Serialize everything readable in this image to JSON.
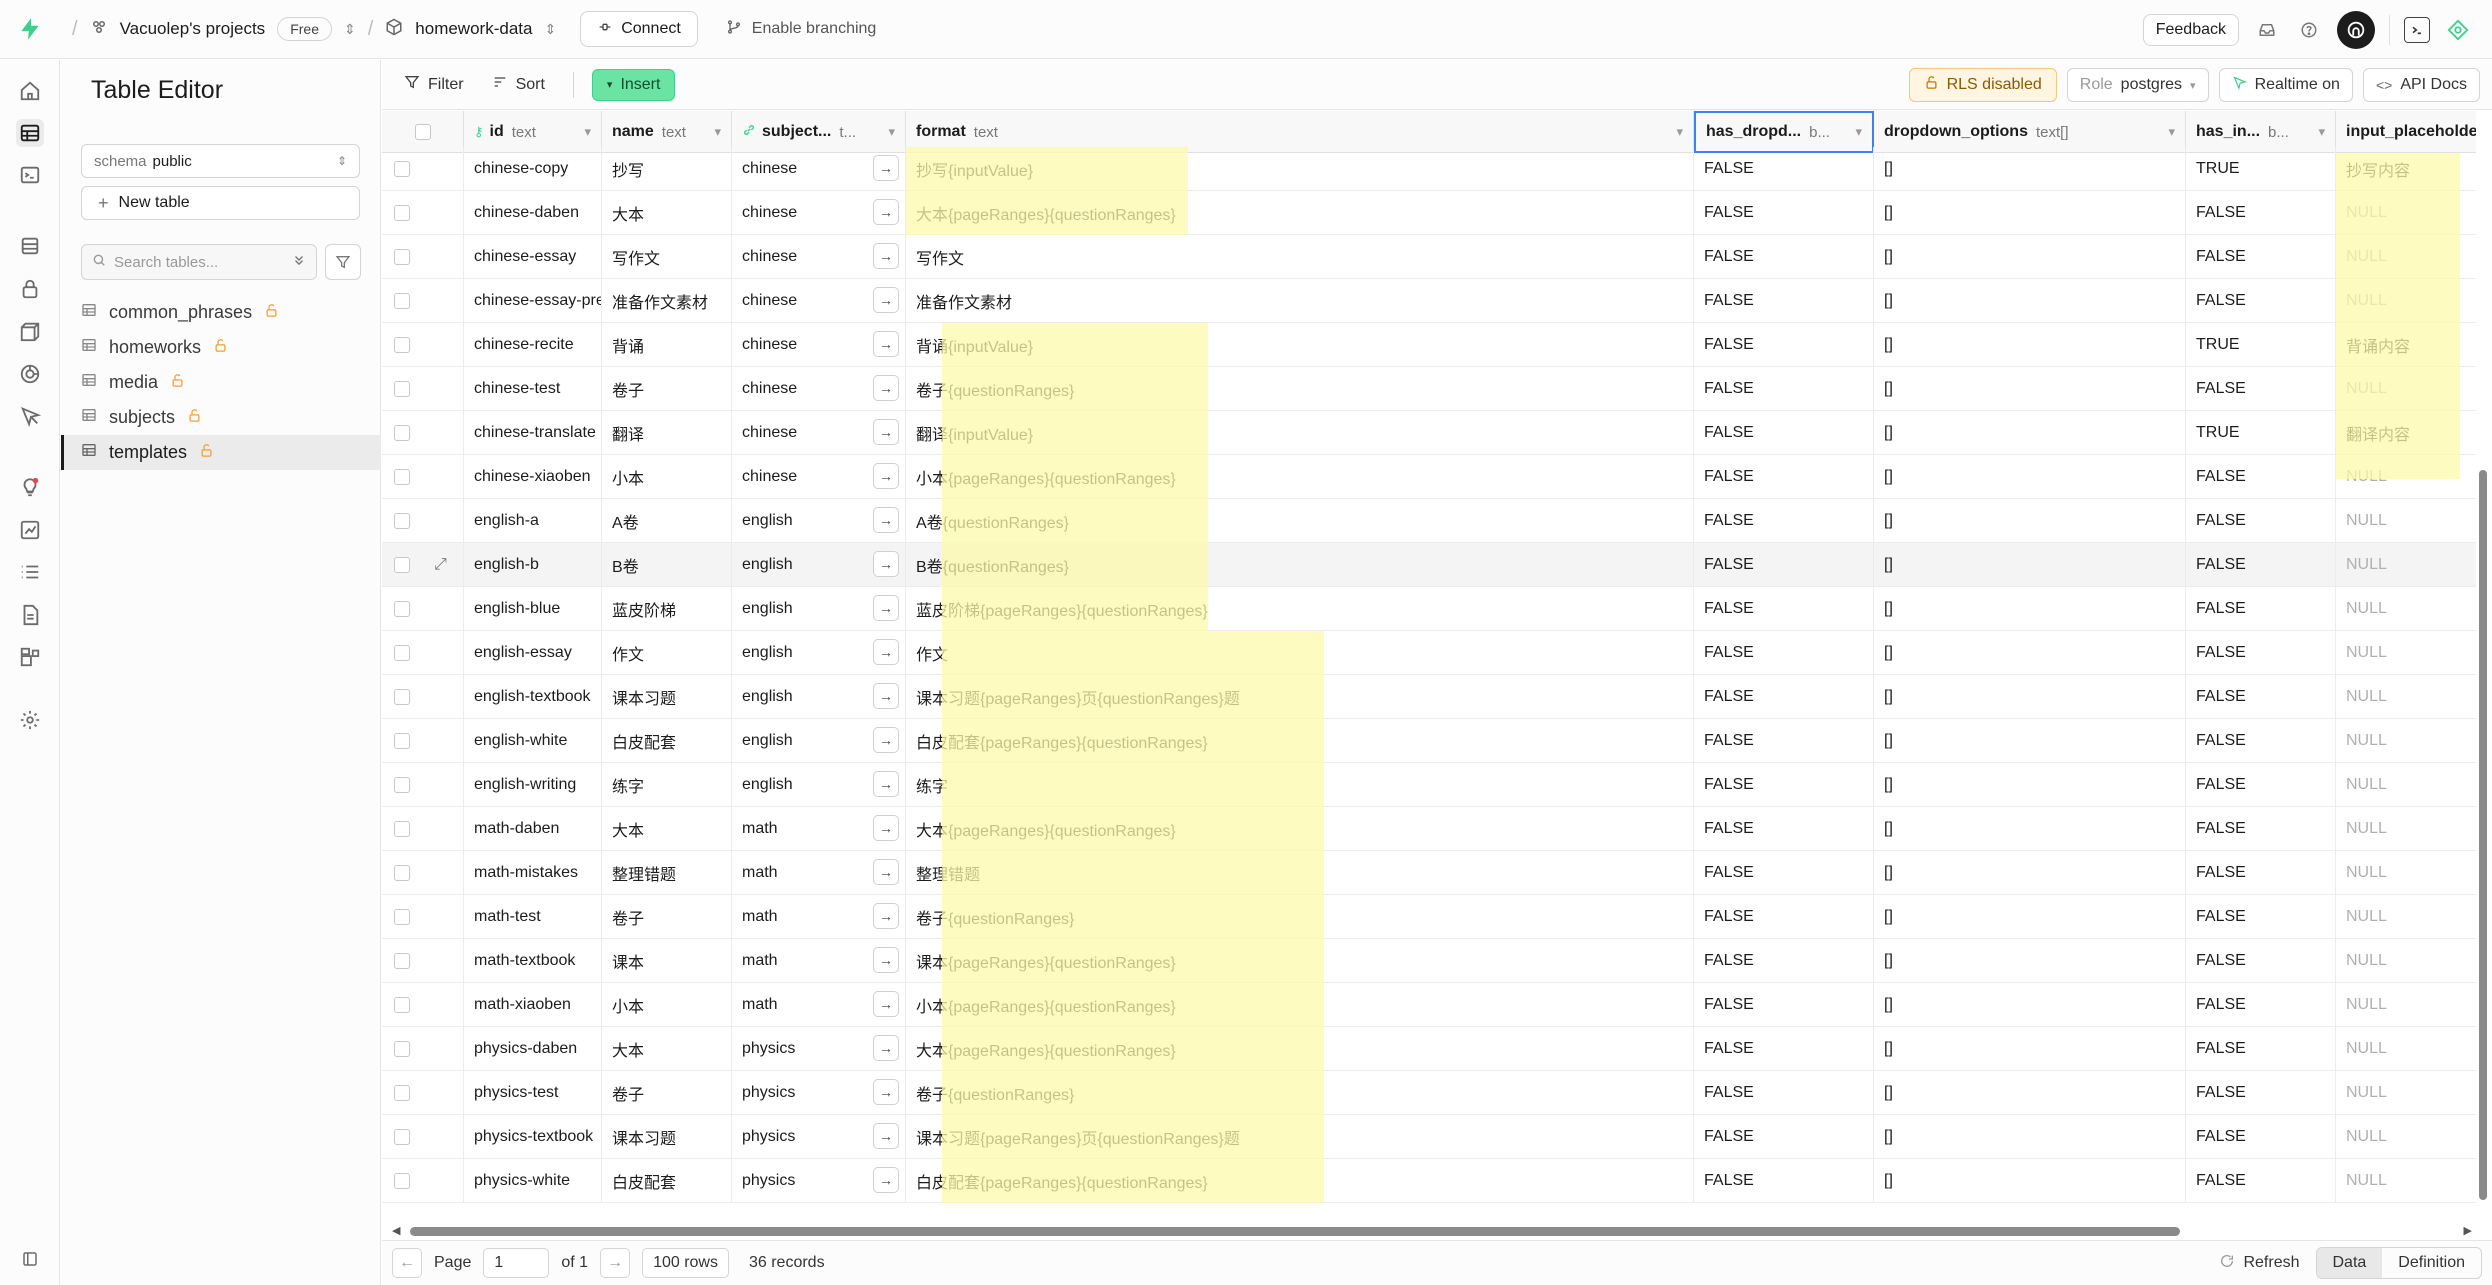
{
  "topbar": {
    "org": "Vacuolep's projects",
    "plan": "Free",
    "project": "homework-data",
    "connect": "Connect",
    "branching": "Enable branching",
    "feedback": "Feedback"
  },
  "sidebar": {
    "title": "Table Editor",
    "schema_label": "schema",
    "schema_value": "public",
    "new_table": "New table",
    "search_placeholder": "Search tables...",
    "tables": [
      "common_phrases",
      "homeworks",
      "media",
      "subjects",
      "templates"
    ]
  },
  "toolbar": {
    "filter": "Filter",
    "sort": "Sort",
    "insert": "Insert",
    "rls": "RLS disabled",
    "role_label": "Role",
    "role_value": "postgres",
    "realtime": "Realtime on",
    "api_docs": "API Docs"
  },
  "columns": [
    {
      "name": "id",
      "type": "text"
    },
    {
      "name": "name",
      "type": "text"
    },
    {
      "name": "subject...",
      "type": "t..."
    },
    {
      "name": "format",
      "type": "text"
    },
    {
      "name": "has_dropd...",
      "type": "b..."
    },
    {
      "name": "dropdown_options",
      "type": "text[]"
    },
    {
      "name": "has_in...",
      "type": "b..."
    },
    {
      "name": "input_placeholder",
      "type": ""
    }
  ],
  "rows": [
    [
      "chinese-copy",
      "抄写",
      "chinese",
      "抄写{inputValue}",
      "FALSE",
      "[]",
      "TRUE",
      "抄写内容"
    ],
    [
      "chinese-daben",
      "大本",
      "chinese",
      "大本{pageRanges}{questionRanges}",
      "FALSE",
      "[]",
      "FALSE",
      "NULL"
    ],
    [
      "chinese-essay",
      "写作文",
      "chinese",
      "写作文",
      "FALSE",
      "[]",
      "FALSE",
      "NULL"
    ],
    [
      "chinese-essay-prep",
      "准备作文素材",
      "chinese",
      "准备作文素材",
      "FALSE",
      "[]",
      "FALSE",
      "NULL"
    ],
    [
      "chinese-recite",
      "背诵",
      "chinese",
      "背诵{inputValue}",
      "FALSE",
      "[]",
      "TRUE",
      "背诵内容"
    ],
    [
      "chinese-test",
      "卷子",
      "chinese",
      "卷子{questionRanges}",
      "FALSE",
      "[]",
      "FALSE",
      "NULL"
    ],
    [
      "chinese-translate",
      "翻译",
      "chinese",
      "翻译{inputValue}",
      "FALSE",
      "[]",
      "TRUE",
      "翻译内容"
    ],
    [
      "chinese-xiaoben",
      "小本",
      "chinese",
      "小本{pageRanges}{questionRanges}",
      "FALSE",
      "[]",
      "FALSE",
      "NULL"
    ],
    [
      "english-a",
      "A卷",
      "english",
      "A卷{questionRanges}",
      "FALSE",
      "[]",
      "FALSE",
      "NULL"
    ],
    [
      "english-b",
      "B卷",
      "english",
      "B卷{questionRanges}",
      "FALSE",
      "[]",
      "FALSE",
      "NULL"
    ],
    [
      "english-blue",
      "蓝皮阶梯",
      "english",
      "蓝皮阶梯{pageRanges}{questionRanges}",
      "FALSE",
      "[]",
      "FALSE",
      "NULL"
    ],
    [
      "english-essay",
      "作文",
      "english",
      "作文",
      "FALSE",
      "[]",
      "FALSE",
      "NULL"
    ],
    [
      "english-textbook",
      "课本习题",
      "english",
      "课本习题{pageRanges}页{questionRanges}题",
      "FALSE",
      "[]",
      "FALSE",
      "NULL"
    ],
    [
      "english-white",
      "白皮配套",
      "english",
      "白皮配套{pageRanges}{questionRanges}",
      "FALSE",
      "[]",
      "FALSE",
      "NULL"
    ],
    [
      "english-writing",
      "练字",
      "english",
      "练字",
      "FALSE",
      "[]",
      "FALSE",
      "NULL"
    ],
    [
      "math-daben",
      "大本",
      "math",
      "大本{pageRanges}{questionRanges}",
      "FALSE",
      "[]",
      "FALSE",
      "NULL"
    ],
    [
      "math-mistakes",
      "整理错题",
      "math",
      "整理错题",
      "FALSE",
      "[]",
      "FALSE",
      "NULL"
    ],
    [
      "math-test",
      "卷子",
      "math",
      "卷子{questionRanges}",
      "FALSE",
      "[]",
      "FALSE",
      "NULL"
    ],
    [
      "math-textbook",
      "课本",
      "math",
      "课本{pageRanges}{questionRanges}",
      "FALSE",
      "[]",
      "FALSE",
      "NULL"
    ],
    [
      "math-xiaoben",
      "小本",
      "math",
      "小本{pageRanges}{questionRanges}",
      "FALSE",
      "[]",
      "FALSE",
      "NULL"
    ],
    [
      "physics-daben",
      "大本",
      "physics",
      "大本{pageRanges}{questionRanges}",
      "FALSE",
      "[]",
      "FALSE",
      "NULL"
    ],
    [
      "physics-test",
      "卷子",
      "physics",
      "卷子{questionRanges}",
      "FALSE",
      "[]",
      "FALSE",
      "NULL"
    ],
    [
      "physics-textbook",
      "课本习题",
      "physics",
      "课本习题{pageRanges}页{questionRanges}题",
      "FALSE",
      "[]",
      "FALSE",
      "NULL"
    ],
    [
      "physics-white",
      "白皮配套",
      "physics",
      "白皮配套{pageRanges}{questionRanges}",
      "FALSE",
      "[]",
      "FALSE",
      "NULL"
    ]
  ],
  "footer": {
    "page_label": "Page",
    "page_value": "1",
    "of_label": "of 1",
    "rows_per_page": "100 rows",
    "records": "36 records",
    "refresh": "Refresh",
    "tab_data": "Data",
    "tab_definition": "Definition"
  },
  "colors": {
    "accent": "#3ecf8e",
    "rls_warning": "#f29d38",
    "highlight": "#fcfaaa"
  },
  "icons": [
    "logo-bolt-icon",
    "org-icon",
    "cube-icon",
    "plug-icon",
    "branch-icon",
    "inbox-icon",
    "help-icon",
    "avatar",
    "terminal-icon",
    "assistant-icon"
  ]
}
